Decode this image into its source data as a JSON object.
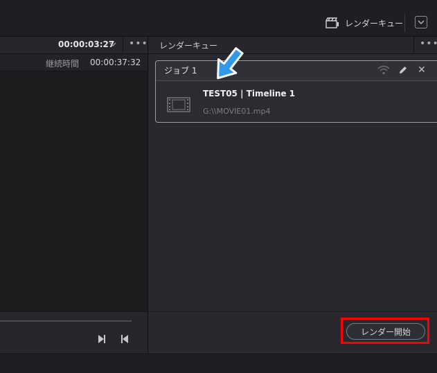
{
  "topbar": {
    "render_queue_button": "レンダーキュー",
    "render_queue_icon": "clapper-icon",
    "menu_icon": "chevron-down-icon"
  },
  "viewer": {
    "timecode": "00:00:03:27",
    "duration_label": "継続時間",
    "duration_value": "00:00:37:32",
    "more_icon": "dots-icon",
    "next_icon": "step-next-icon",
    "prev_icon": "step-prev-icon"
  },
  "render_queue": {
    "title": "レンダーキュー",
    "more_icon": "dots-icon",
    "jobs": [
      {
        "title": "ジョブ 1",
        "name": "TEST05 | Timeline 1",
        "path": "G:\\\\MOVIE01.mp4"
      }
    ],
    "start_button": "レンダー開始"
  },
  "colors": {
    "highlight": "#ff0000",
    "arrow": "#2f9be8"
  }
}
